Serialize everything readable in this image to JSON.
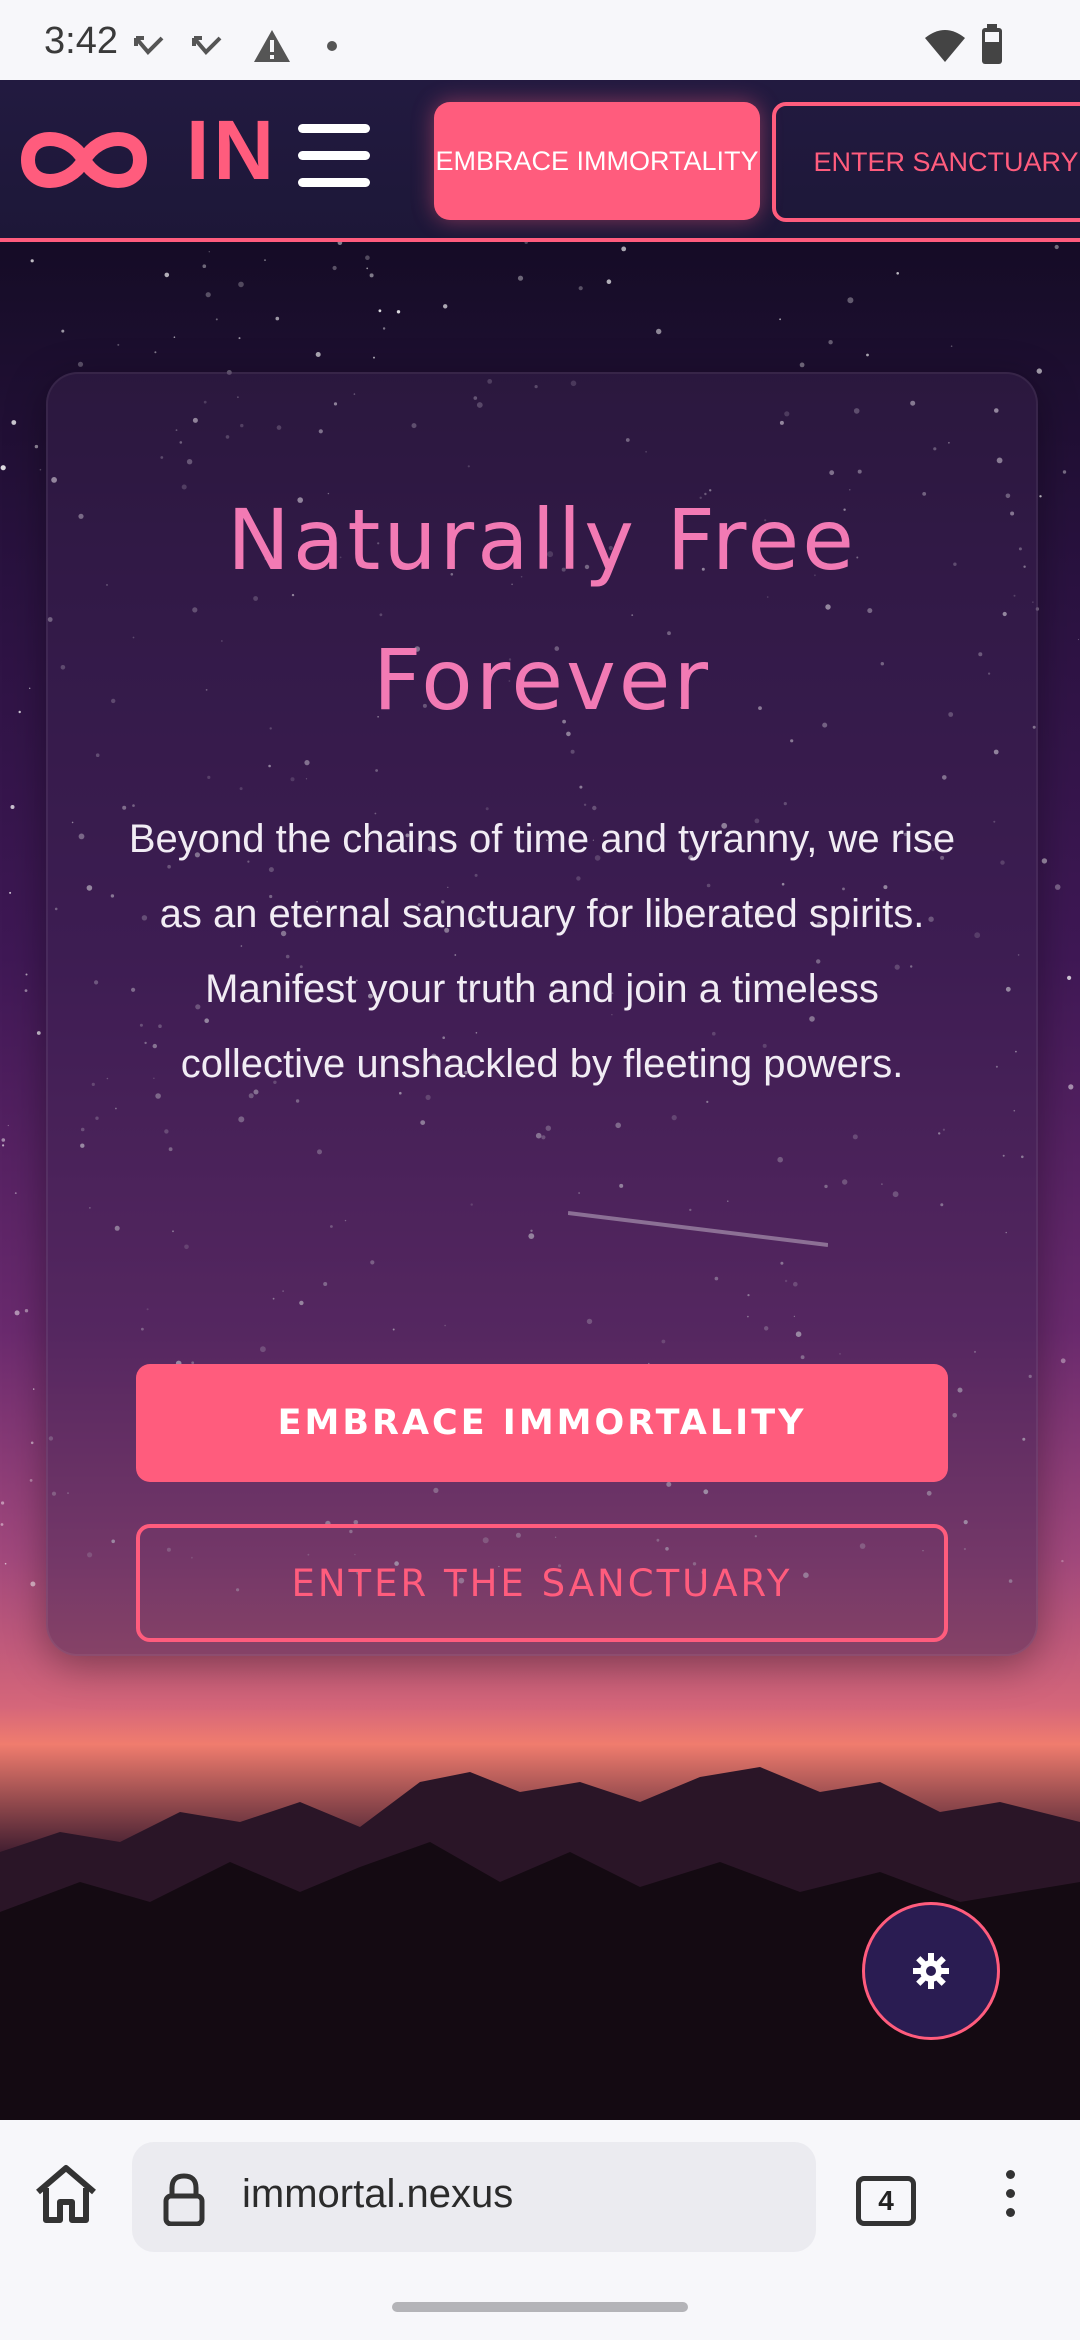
{
  "status_bar": {
    "time": "3:42",
    "icons": [
      "missed-call-icon",
      "missed-call-icon",
      "warning-icon",
      "dot-icon",
      "wifi-icon",
      "battery-icon"
    ]
  },
  "nav": {
    "logo_symbol": "∞",
    "logo_text": "IN",
    "menu_icon": "hamburger-icon",
    "primary_button": "EMBRACE IMMORTALITY",
    "secondary_button": "ENTER SANCTUARY"
  },
  "hero": {
    "title": "Naturally Free Forever",
    "description": "Beyond the chains of time and tyranny, we rise as an eternal sanctuary for liberated spirits. Manifest your truth and join a timeless collective unshackled by fleeting powers.",
    "primary_cta": "EMBRACE IMMORTALITY",
    "secondary_cta": "ENTER THE SANCTUARY"
  },
  "fab": {
    "icon": "settings-gear-icon"
  },
  "browser": {
    "url": "immortal.nexus",
    "tab_count": "4"
  },
  "colors": {
    "accent": "#ff5c7d",
    "title_pink": "#f27ab4",
    "nav_bg": "#1d1738"
  }
}
